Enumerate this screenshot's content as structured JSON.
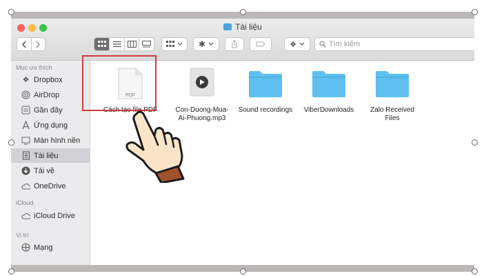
{
  "window": {
    "title": "Tài liệu",
    "title_icon": "folder-icon",
    "traffic_lights": [
      "#fc605c",
      "#fdbc40",
      "#34c84a"
    ]
  },
  "toolbar": {
    "back_icon": "chevron-left-icon",
    "forward_icon": "chevron-right-icon",
    "view_icons": [
      "icon-view-icon",
      "list-view-icon",
      "column-view-icon",
      "gallery-view-icon"
    ],
    "group_icon": "group-by-icon",
    "action_icon": "gear-icon",
    "share_icon": "share-icon",
    "tag_icon": "tag-icon",
    "dropbox_icon": "dropbox-icon",
    "search": {
      "placeholder": "Tìm kiếm",
      "icon": "search-icon"
    }
  },
  "sidebar": {
    "sections": [
      {
        "title": "Mục ưa thích",
        "items": [
          {
            "label": "Dropbox",
            "icon": "dropbox-icon"
          },
          {
            "label": "AirDrop",
            "icon": "airdrop-icon"
          },
          {
            "label": "Gần đây",
            "icon": "recents-icon"
          },
          {
            "label": "Ứng dụng",
            "icon": "applications-icon"
          },
          {
            "label": "Màn hình nền",
            "icon": "desktop-icon"
          },
          {
            "label": "Tài liệu",
            "icon": "documents-icon",
            "selected": true
          },
          {
            "label": "Tải về",
            "icon": "downloads-icon"
          },
          {
            "label": "OneDrive",
            "icon": "cloud-icon"
          }
        ]
      },
      {
        "title": "iCloud",
        "items": [
          {
            "label": "iCloud Drive",
            "icon": "icloud-icon"
          }
        ]
      },
      {
        "title": "Vị trí",
        "items": [
          {
            "label": "Mạng",
            "icon": "network-icon"
          }
        ]
      }
    ]
  },
  "files": [
    {
      "name": "Cách tạo file PDF",
      "kind": "pdf",
      "badge": "PDF",
      "highlighted": true
    },
    {
      "name": "Con-Duong-Mua-Ai-Phuong.mp3",
      "name_lines": [
        "Con-Duong-Mua-",
        "Ai-Phuong.mp3"
      ],
      "kind": "audio"
    },
    {
      "name": "Sound recordings",
      "kind": "folder"
    },
    {
      "name": "ViberDownloads",
      "kind": "folder"
    },
    {
      "name": "Zalo Received Files",
      "name_lines": [
        "Zalo Received",
        "Files"
      ],
      "kind": "folder"
    }
  ],
  "colors": {
    "accent_highlight": "#d23a3a",
    "folder": "#5fc0ef",
    "sidebar_bg": "#ebebee",
    "selection": "#d2d2d6"
  }
}
